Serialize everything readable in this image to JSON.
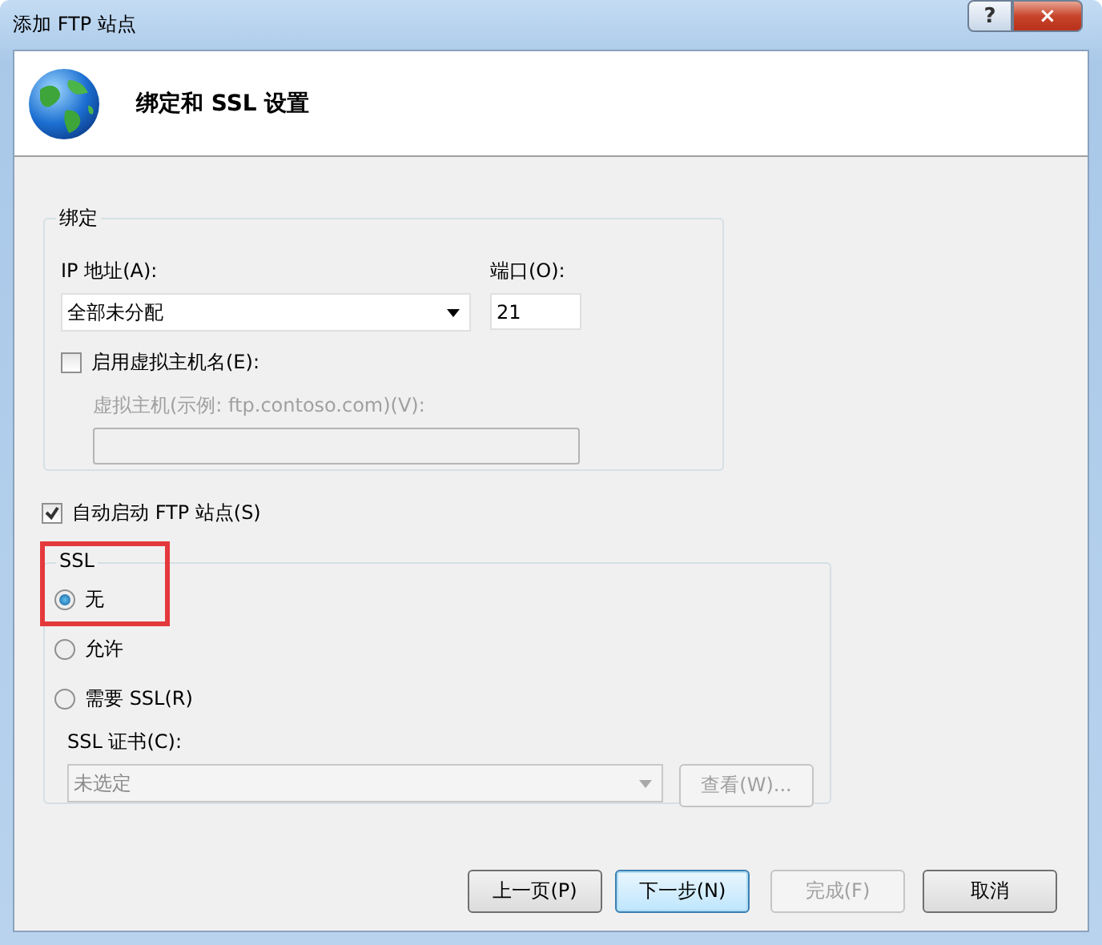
{
  "window": {
    "title": "添加 FTP 站点",
    "help": "?",
    "close": "×"
  },
  "header": {
    "title": "绑定和 SSL 设置"
  },
  "binding": {
    "label": "绑定",
    "ip_label": "IP 地址(A):",
    "ip_value": "全部未分配",
    "port_label": "端口(O):",
    "port_value": "21",
    "virtual_host": {
      "label": "启用虚拟主机名(E):",
      "checked": false
    },
    "host_label": "虚拟主机(示例: ftp.contoso.com)(V):",
    "host_disabled": true
  },
  "auto_start": {
    "label": "自动启动 FTP 站点(S)",
    "checked": true
  },
  "ssl": {
    "label": "SSL",
    "options": [
      {
        "label": "无",
        "selected": true
      },
      {
        "label": "允许",
        "selected": false
      },
      {
        "label": "需要 SSL(R)",
        "selected": false
      }
    ],
    "cert_label": "SSL 证书(C):",
    "cert_value": "未选定",
    "cert_disabled": true,
    "view_button": {
      "label": "查看(W)...",
      "disabled": true
    }
  },
  "buttons": [
    {
      "label": "上一页(P)",
      "disabled": false,
      "focused": false
    },
    {
      "label": "下一步(N)",
      "disabled": false,
      "focused": true
    },
    {
      "label": "完成(F)",
      "disabled": true,
      "focused": false
    },
    {
      "label": "取消",
      "disabled": false,
      "focused": false
    }
  ]
}
